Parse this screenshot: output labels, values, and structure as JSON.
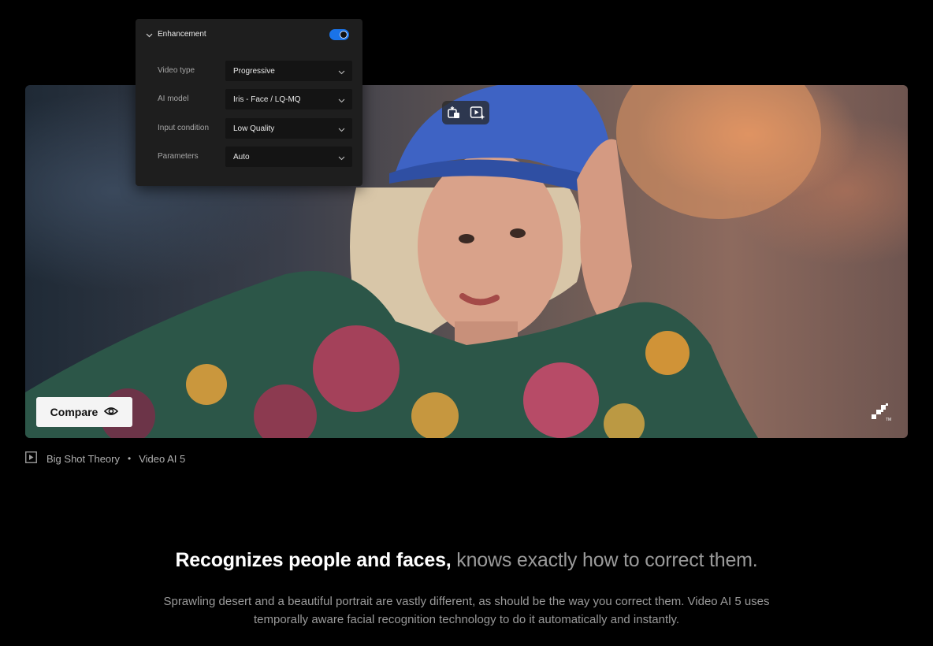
{
  "panel": {
    "title": "Enhancement",
    "toggle_on": true,
    "rows": [
      {
        "label": "Video type",
        "value": "Progressive"
      },
      {
        "label": "AI model",
        "value": "Iris - Face / LQ-MQ"
      },
      {
        "label": "Input condition",
        "value": "Low Quality"
      },
      {
        "label": "Parameters",
        "value": "Auto"
      }
    ]
  },
  "video": {
    "tools": [
      "crop-compare-icon",
      "enhance-play-icon"
    ],
    "compare_label": "Compare",
    "compare_icon": "eye-icon",
    "logo_icon": "topaz-logo-icon"
  },
  "caption": {
    "icon": "play-square-icon",
    "author": "Big Shot Theory",
    "separator": "•",
    "product": "Video AI 5"
  },
  "headline": {
    "strong": "Recognizes people and faces,",
    "muted": "knows exactly how to correct them."
  },
  "body": "Sprawling desert and a beautiful portrait are vastly different, as should be the way you correct them. Video AI 5 uses temporally aware facial recognition technology to do it automatically and instantly.",
  "colors": {
    "background": "#000000",
    "toggle_accent": "#1a73e8",
    "hat_blue": "#3e63c4"
  }
}
